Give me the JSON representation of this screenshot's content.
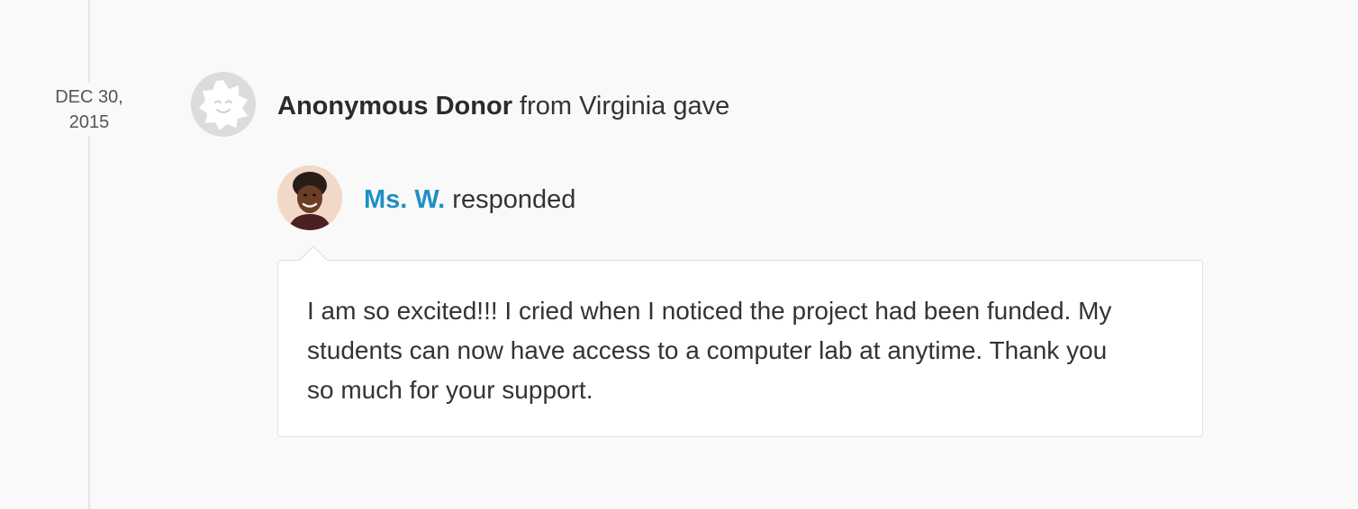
{
  "timeline": {
    "date_month_day": "DEC 30,",
    "date_year": "2015"
  },
  "donation": {
    "donor_avatar_icon": "smiling-star-face-icon",
    "donor_name": "Anonymous Donor",
    "donor_detail": " from Virginia gave"
  },
  "response": {
    "teacher_avatar_icon": "teacher-photo",
    "teacher_name": "Ms. W.",
    "response_verb": " responded",
    "message": "I am so excited!!! I cried when I noticed the project had been funded. My students can now have access to a computer lab at anytime. Thank you so much for your support."
  },
  "colors": {
    "background": "#f9f9f9",
    "link": "#1e8fc6",
    "text": "#333333"
  }
}
